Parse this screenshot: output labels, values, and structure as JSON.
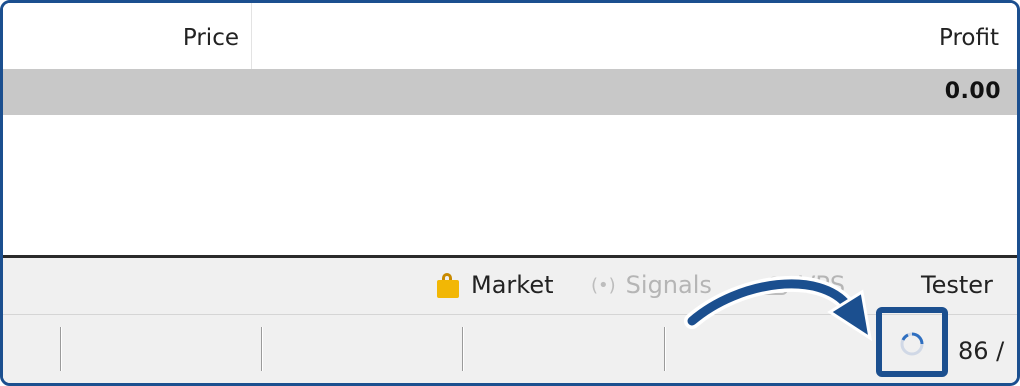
{
  "table": {
    "columns": [
      "Price",
      "Profit"
    ],
    "total_profit": "0.00"
  },
  "tabs": [
    {
      "label": "Market",
      "icon": "shopping-bag-icon",
      "enabled": true
    },
    {
      "label": "Signals",
      "icon": "signal-broadcast-icon",
      "enabled": false
    },
    {
      "label": "VPS",
      "icon": "cloud-icon",
      "enabled": false
    },
    {
      "label": "Tester",
      "enabled": true
    }
  ],
  "statusbar": {
    "connection_text": "86 /"
  },
  "colors": {
    "highlight": "#1b4f8f",
    "total_row": "#c8c8c8",
    "disabled_text": "#b5b5b5"
  }
}
